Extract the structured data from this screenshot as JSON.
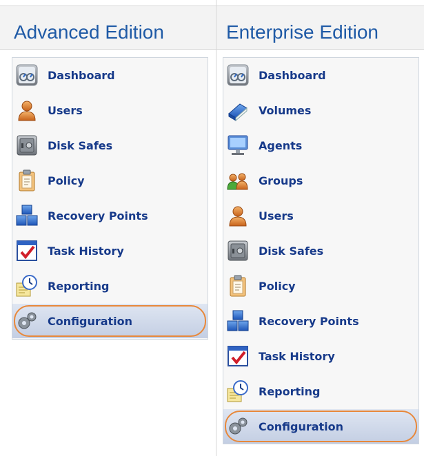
{
  "columns": [
    {
      "title": "Advanced Edition",
      "items": [
        {
          "label": "Dashboard",
          "icon": "dashboard-icon"
        },
        {
          "label": "Users",
          "icon": "user-icon"
        },
        {
          "label": "Disk Safes",
          "icon": "safe-icon"
        },
        {
          "label": "Policy",
          "icon": "clipboard-icon"
        },
        {
          "label": "Recovery Points",
          "icon": "cubes-icon"
        },
        {
          "label": "Task History",
          "icon": "checklist-icon"
        },
        {
          "label": "Reporting",
          "icon": "clock-report-icon"
        },
        {
          "label": "Configuration",
          "icon": "gears-icon",
          "selected": true
        }
      ]
    },
    {
      "title": "Enterprise Edition",
      "items": [
        {
          "label": "Dashboard",
          "icon": "dashboard-icon"
        },
        {
          "label": "Volumes",
          "icon": "book-icon"
        },
        {
          "label": "Agents",
          "icon": "monitor-icon"
        },
        {
          "label": "Groups",
          "icon": "group-icon"
        },
        {
          "label": "Users",
          "icon": "user-icon"
        },
        {
          "label": "Disk Safes",
          "icon": "safe-icon"
        },
        {
          "label": "Policy",
          "icon": "clipboard-icon"
        },
        {
          "label": "Recovery Points",
          "icon": "cubes-icon"
        },
        {
          "label": "Task History",
          "icon": "checklist-icon"
        },
        {
          "label": "Reporting",
          "icon": "clock-report-icon"
        },
        {
          "label": "Configuration",
          "icon": "gears-icon",
          "selected": true
        }
      ]
    }
  ],
  "colors": {
    "title": "#1f5aa6",
    "item_label": "#173a8a",
    "selection_ring": "#e8883a",
    "header_bg": "#f3f3f3",
    "grid": "#d6d6d6"
  }
}
